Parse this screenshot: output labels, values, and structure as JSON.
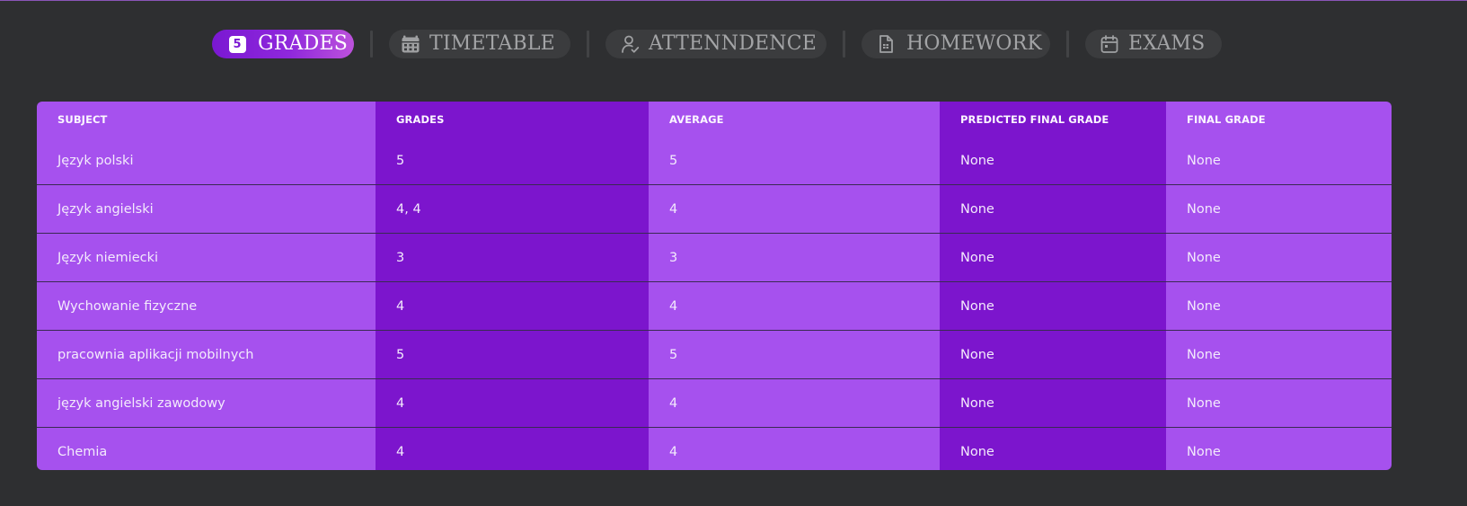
{
  "nav": {
    "tabs": [
      {
        "label": "GRADES",
        "icon": "grade-5-badge-icon",
        "badge": "5",
        "active": true
      },
      {
        "label": "TIMETABLE",
        "icon": "calendar-grid-icon",
        "active": false
      },
      {
        "label": "ATTENNDENCE",
        "icon": "user-check-icon",
        "active": false
      },
      {
        "label": "HOMEWORK",
        "icon": "document-icon",
        "active": false
      },
      {
        "label": "EXAMS",
        "icon": "calendar-icon",
        "active": false
      }
    ]
  },
  "colors": {
    "background": "#2e2f31",
    "accent": "#7c15cd",
    "accent_light": "#a651ee",
    "tab_bg": "#3b3c3e",
    "tab_text": "#a3a4a6"
  },
  "table": {
    "headers": [
      "SUBJECT",
      "GRADES",
      "AVERAGE",
      "PREDICTED FINAL GRADE",
      "FINAL GRADE"
    ],
    "rows": [
      [
        "Język polski",
        "5",
        "5",
        "None",
        "None"
      ],
      [
        "Język angielski",
        "4, 4",
        "4",
        "None",
        "None"
      ],
      [
        "Język niemiecki",
        "3",
        "3",
        "None",
        "None"
      ],
      [
        "Wychowanie fizyczne",
        "4",
        "4",
        "None",
        "None"
      ],
      [
        "pracownia aplikacji mobilnych",
        "5",
        "5",
        "None",
        "None"
      ],
      [
        "język angielski zawodowy",
        "4",
        "4",
        "None",
        "None"
      ],
      [
        "Chemia",
        "4",
        "4",
        "None",
        "None"
      ]
    ]
  }
}
